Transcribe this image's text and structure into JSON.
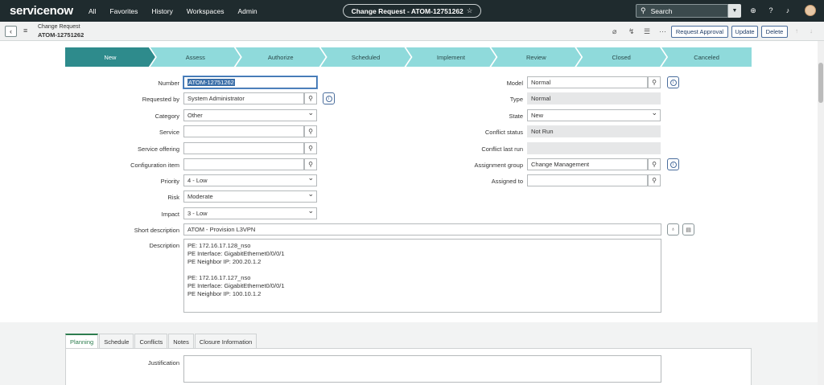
{
  "topnav": {
    "brand": "servicenow",
    "links": [
      "All",
      "Favorites",
      "History",
      "Workspaces",
      "Admin"
    ],
    "context_title": "Change Request - ATOM-12751262",
    "search_placeholder": "Search"
  },
  "header": {
    "title_line1": "Change Request",
    "title_line2": "ATOM-12751262",
    "buttons": {
      "request_approval": "Request Approval",
      "update": "Update",
      "delete": "Delete"
    }
  },
  "stages": [
    {
      "label": "New",
      "active": true
    },
    {
      "label": "Assess",
      "active": false
    },
    {
      "label": "Authorize",
      "active": false
    },
    {
      "label": "Scheduled",
      "active": false
    },
    {
      "label": "Implement",
      "active": false
    },
    {
      "label": "Review",
      "active": false
    },
    {
      "label": "Closed",
      "active": false
    },
    {
      "label": "Canceled",
      "active": false
    }
  ],
  "form": {
    "number": {
      "label": "Number",
      "value": "ATOM-12751262"
    },
    "requested_by": {
      "label": "Requested by",
      "value": "System Administrator"
    },
    "category": {
      "label": "Category",
      "value": "Other"
    },
    "service": {
      "label": "Service",
      "value": ""
    },
    "service_offering": {
      "label": "Service offering",
      "value": ""
    },
    "configuration_item": {
      "label": "Configuration item",
      "value": ""
    },
    "priority": {
      "label": "Priority",
      "value": "4 - Low"
    },
    "risk": {
      "label": "Risk",
      "value": "Moderate"
    },
    "impact": {
      "label": "Impact",
      "value": "3 - Low"
    },
    "model": {
      "label": "Model",
      "value": "Normal"
    },
    "type": {
      "label": "Type",
      "value": "Normal"
    },
    "state": {
      "label": "State",
      "value": "New"
    },
    "conflict_status": {
      "label": "Conflict status",
      "value": "Not Run"
    },
    "conflict_last_run": {
      "label": "Conflict last run",
      "value": ""
    },
    "assignment_group": {
      "label": "Assignment group",
      "value": "Change Management"
    },
    "assigned_to": {
      "label": "Assigned to",
      "value": ""
    },
    "short_description": {
      "label": "Short description",
      "value": "ATOM - Provision L3VPN"
    },
    "description": {
      "label": "Description",
      "lines": [
        "PE: 172.16.17.128_nso",
        "PE Interface: GigabitEthernet0/0/0/1",
        "PE Neighbor IP: 200.20.1.2",
        "",
        "PE: 172.16.17.127_nso",
        "PE Interface: GigabitEthernet0/0/0/1",
        "PE Neighbor IP: 100.10.1.2"
      ]
    }
  },
  "tabs": [
    {
      "label": "Planning",
      "active": true
    },
    {
      "label": "Schedule",
      "active": false
    },
    {
      "label": "Conflicts",
      "active": false
    },
    {
      "label": "Notes",
      "active": false
    },
    {
      "label": "Closure Information",
      "active": false
    }
  ],
  "planning": {
    "justification_label": "Justification"
  }
}
